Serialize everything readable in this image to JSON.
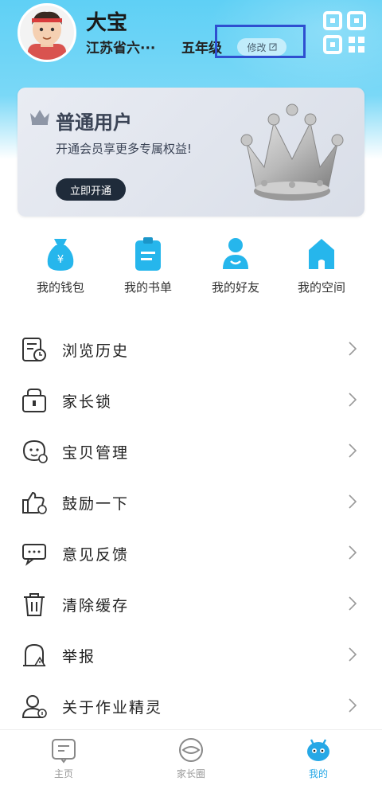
{
  "profile": {
    "name": "大宝",
    "school": "江苏省六···",
    "grade": "五年级",
    "edit_label": "修改"
  },
  "vip": {
    "title": "普通用户",
    "subtitle": "开通会员享更多专属权益!",
    "button": "立即开通"
  },
  "quick_actions": [
    {
      "label": "我的钱包",
      "icon": "wallet-icon"
    },
    {
      "label": "我的书单",
      "icon": "booklist-icon"
    },
    {
      "label": "我的好友",
      "icon": "friends-icon"
    },
    {
      "label": "我的空间",
      "icon": "space-icon"
    }
  ],
  "menu": [
    {
      "label": "浏览历史",
      "icon": "history-icon"
    },
    {
      "label": "家长锁",
      "icon": "parent-lock-icon"
    },
    {
      "label": "宝贝管理",
      "icon": "child-manage-icon"
    },
    {
      "label": "鼓励一下",
      "icon": "thumbs-up-icon"
    },
    {
      "label": "意见反馈",
      "icon": "feedback-icon"
    },
    {
      "label": "清除缓存",
      "icon": "trash-icon"
    },
    {
      "label": "举报",
      "icon": "report-icon"
    },
    {
      "label": "关于作业精灵",
      "icon": "about-icon"
    }
  ],
  "bottom_nav": [
    {
      "label": "主页",
      "icon": "home-icon",
      "active": false
    },
    {
      "label": "家长圈",
      "icon": "parent-circle-icon",
      "active": false
    },
    {
      "label": "我的",
      "icon": "mine-icon",
      "active": true
    }
  ],
  "colors": {
    "accent": "#26a8e6",
    "header_top": "#5fd0f5",
    "highlight_box": "#2e4fd0",
    "vip_button": "#1f2b3a"
  }
}
